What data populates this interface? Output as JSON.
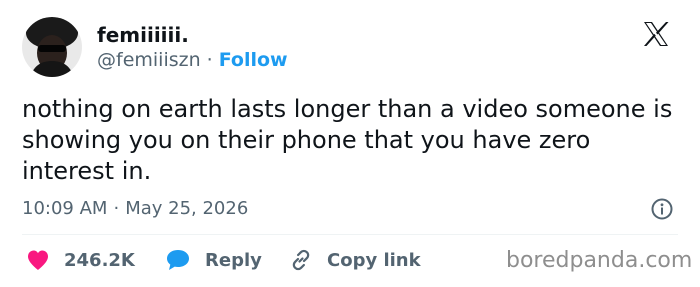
{
  "author": {
    "display_name": "femiiiiii.",
    "handle": "@femiiiszn",
    "separator": "·",
    "follow_label": "Follow"
  },
  "tweet": {
    "text": "nothing on earth lasts longer than a video someone is showing you on their phone that you have zero interest in.",
    "time": "10:09 AM",
    "separator": "·",
    "date": "May 25, 2026"
  },
  "actions": {
    "like_count": "246.2K",
    "reply_label": "Reply",
    "copy_link_label": "Copy link"
  },
  "watermark": "boredpanda.com",
  "icons": {
    "brand": "x-logo-icon",
    "info": "info-icon",
    "like": "heart-icon",
    "reply": "speech-bubble-icon",
    "copy": "link-icon"
  },
  "colors": {
    "text": "#0f1419",
    "secondary": "#536471",
    "link": "#1d9bf0",
    "like": "#f91880",
    "divider": "#eff3f4"
  }
}
